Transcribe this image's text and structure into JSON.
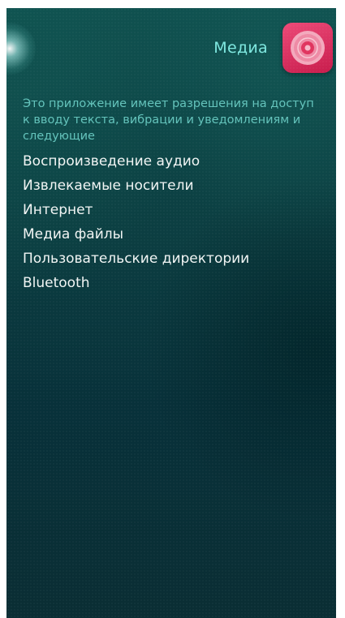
{
  "header": {
    "title": "Медиа",
    "icon": "music-disc-icon",
    "icon_color": "#d82458",
    "title_color": "#7ee8e0"
  },
  "permissions": {
    "intro": "Это приложение имеет разрешения на доступ к вводу текста, вибрации и уведомлениям и следующие",
    "items": [
      "Воспроизведение аудио",
      "Извлекаемые носители",
      "Интернет",
      "Медиа файлы",
      "Пользовательские директории",
      "Bluetooth"
    ]
  }
}
